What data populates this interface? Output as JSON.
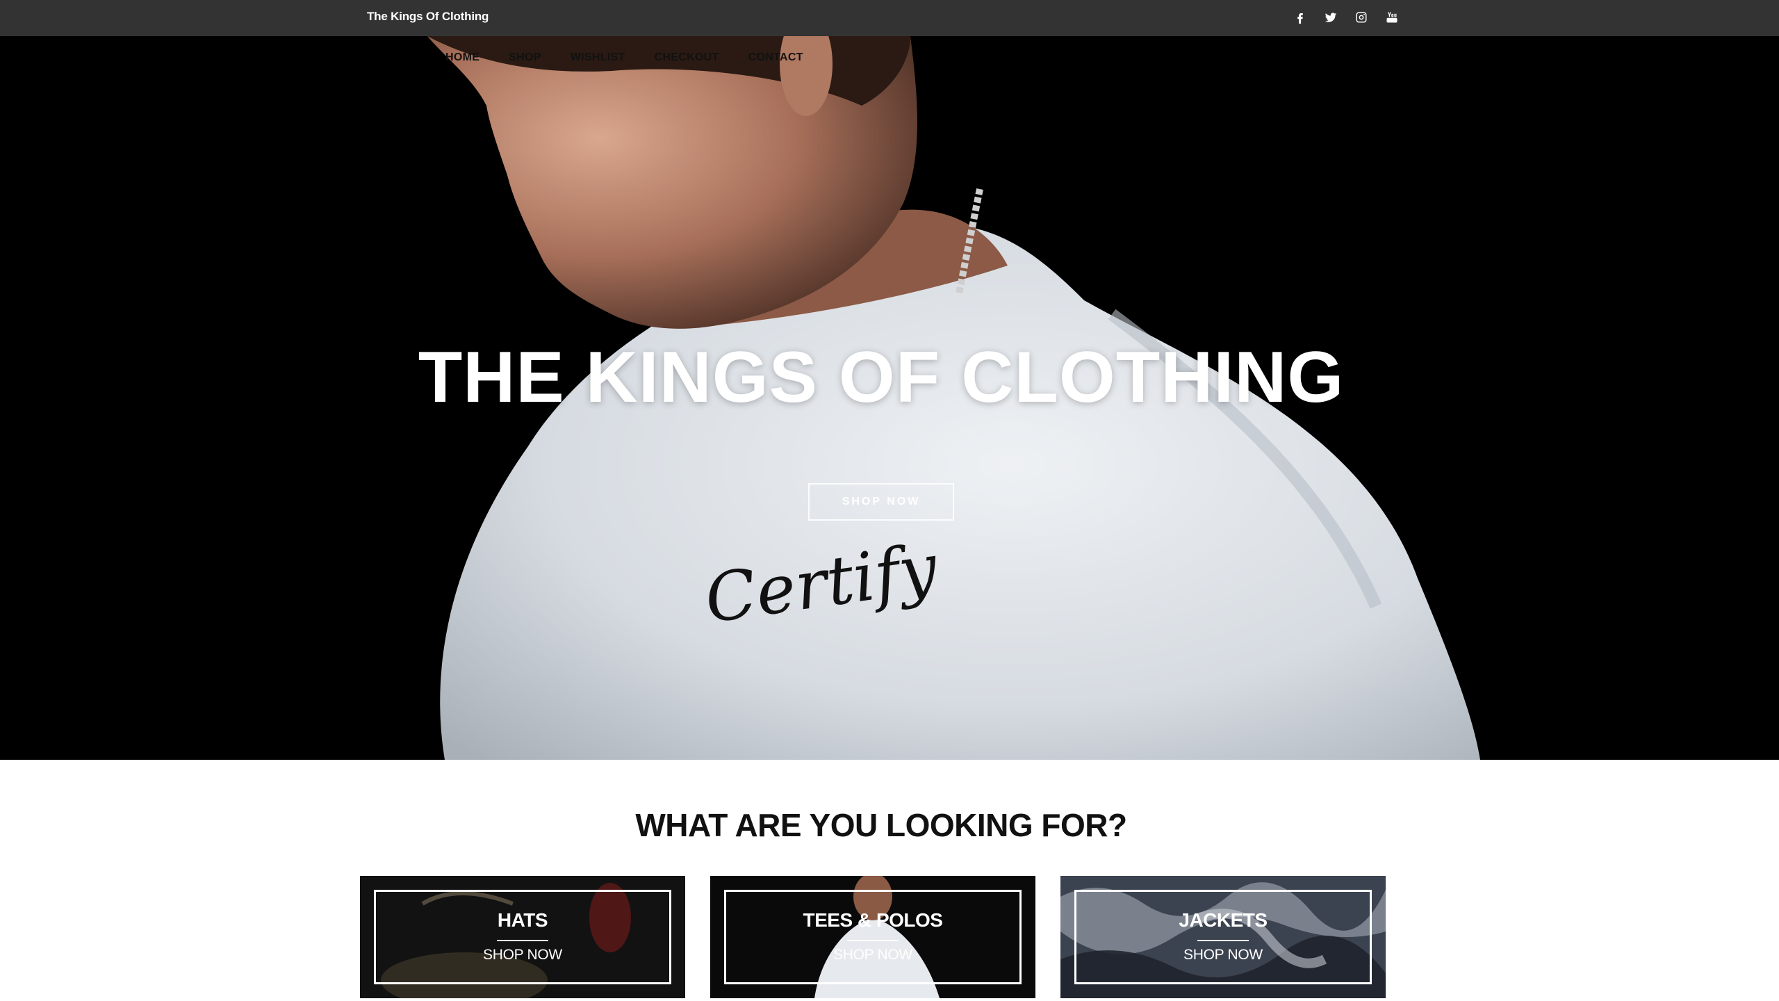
{
  "site": {
    "brand": "The Kings Of Clothing",
    "social_icons": [
      "facebook-icon",
      "twitter-icon",
      "instagram-icon",
      "youtube-icon"
    ]
  },
  "nav": {
    "items": [
      "HOME",
      "SHOP",
      "WISHLIST",
      "CHECKOUT",
      "CONTACT"
    ]
  },
  "hero": {
    "title": "THE KINGS OF CLOTHING",
    "cta": "SHOP NOW",
    "shirt_logo": "Certify"
  },
  "categories": {
    "heading": "WHAT ARE YOU LOOKING FOR?",
    "items": [
      {
        "label": "HATS",
        "cta": "SHOP NOW"
      },
      {
        "label": "TEES & POLOS",
        "cta": "SHOP NOW"
      },
      {
        "label": "JACKETS",
        "cta": "SHOP NOW"
      }
    ]
  },
  "colors": {
    "topbar": "#333333",
    "hero_background": "#000000",
    "text_dark": "#111111",
    "white": "#ffffff"
  }
}
